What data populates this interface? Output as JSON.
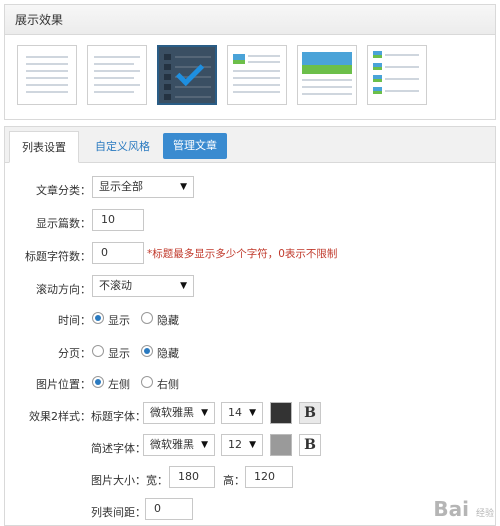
{
  "display_panel": {
    "title": "展示效果"
  },
  "tabs": {
    "list_settings": "列表设置",
    "custom_style": "自定义风格",
    "manage_articles": "管理文章"
  },
  "form": {
    "category_label": "文章分类：",
    "category_value": "显示全部",
    "count_label": "显示篇数：",
    "count_value": "10",
    "title_chars_label": "标题字符数：",
    "title_chars_value": "0",
    "title_chars_hint": "*标题最多显示多少个字符，0表示不限制",
    "scroll_label": "滚动方向：",
    "scroll_value": "不滚动",
    "time_label": "时间：",
    "time_show": "显示",
    "time_hide": "隐藏",
    "paging_label": "分页：",
    "paging_show": "显示",
    "paging_hide": "隐藏",
    "imgpos_label": "图片位置：",
    "imgpos_left": "左侧",
    "imgpos_right": "右侧",
    "style2_label": "效果2样式：",
    "title_font_label": "标题字体：",
    "title_font_value": "微软雅黑",
    "title_size_value": "14",
    "title_color": "#333333",
    "desc_font_label": "简述字体：",
    "desc_font_value": "微软雅黑",
    "desc_size_value": "12",
    "desc_color": "#9a9a9a",
    "bold_label": "B",
    "imgsize_label": "图片大小：宽：",
    "imgsize_width": "180",
    "imgsize_height_label": "高：",
    "imgsize_height": "120",
    "spacing_label": "列表间距：",
    "spacing_value": "0"
  },
  "watermark": {
    "text": "Bai",
    "sub": "经验"
  }
}
